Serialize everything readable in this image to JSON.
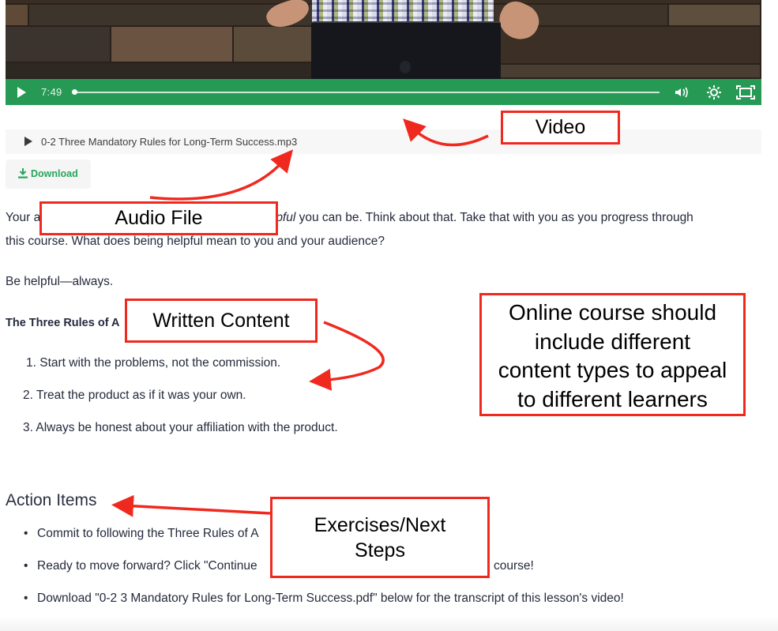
{
  "video": {
    "time": "7:49",
    "progress_percent": 0,
    "controls": {
      "play_icon": "play-icon",
      "volume_icon": "volume-icon",
      "settings_icon": "gear-icon",
      "fullscreen_icon": "fullscreen-icon"
    },
    "accent_color": "#269a55"
  },
  "audio": {
    "filename": "0-2 Three Mandatory Rules for Long-Term Success.mp3",
    "play_icon": "play-icon"
  },
  "download": {
    "label": "Download",
    "icon": "download-icon",
    "color": "#26a65b"
  },
  "content": {
    "intro_line1_start": "Your a",
    "intro_line1_italic": "elpful",
    "intro_line1_end": " you can be. Think about that. Take that with you as you progress through",
    "intro_line2": "this course. What does being helpful mean to you and your audience?",
    "be_helpful": "Be helpful—always.",
    "rules_heading": "The Three Rules of A",
    "rules": [
      "1. Start with the problems, not the commission.",
      "2. Treat the product as if it was your own.",
      "3. Always be honest about your affiliation with the product."
    ],
    "action_items_heading": "Action Items",
    "action_items": [
      {
        "visible_start": "Commit to following the Three Rules of A",
        "visible_end": ""
      },
      {
        "visible_start": "Ready to move forward? Click \"Continue",
        "visible_end": "course!"
      },
      {
        "visible_start": "Download \"0-2 3 Mandatory Rules for Long-Term Success.pdf\" below for the transcript of this lesson's video!",
        "visible_end": ""
      }
    ]
  },
  "annotations": {
    "video_label": "Video",
    "audio_label": "Audio File",
    "written_label": "Written Content",
    "summary_lines": [
      "Online course should",
      "include different",
      "content types to appeal",
      "to different learners"
    ],
    "exercises_lines": [
      "Exercises/Next",
      "Steps"
    ],
    "color": "#f0291f"
  }
}
